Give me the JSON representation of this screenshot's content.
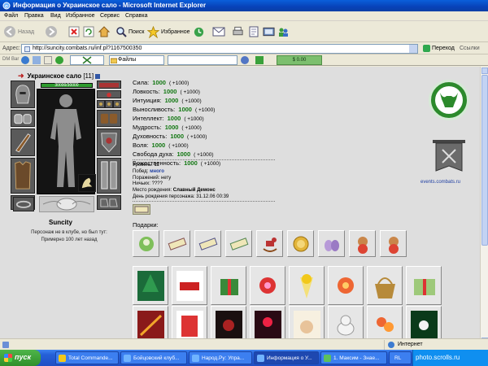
{
  "window": {
    "title": "Информация о Украинское сало - Microsoft Internet Explorer"
  },
  "menu": [
    "Файл",
    "Правка",
    "Вид",
    "Избранное",
    "Сервис",
    "Справка"
  ],
  "toolbar": {
    "back": "Назад",
    "search": "Поиск",
    "favorites": "Избранное"
  },
  "address": {
    "label": "Адрес:",
    "url": "http://suncity.combats.ru/inf.pl?1167500350",
    "go": "Переход",
    "links": "Ссылки"
  },
  "dmbar": {
    "label": "DM Bar",
    "files": "Файлы",
    "balance": "$ 0.00"
  },
  "character": {
    "name_line": "Украинское сало",
    "level_tag": "[11]",
    "hp": "30000/30000",
    "city": "Suncity",
    "note_line1": "Персонаж не в клубе, но был тут:",
    "note_line2": "Примерно 100 лет назад"
  },
  "stats": [
    {
      "label": "Сила:",
      "value": "1000",
      "bonus": "( +1000)"
    },
    {
      "label": "Ловкость:",
      "value": "1000",
      "bonus": "( +1000)"
    },
    {
      "label": "Интуиция:",
      "value": "1000",
      "bonus": "( +1000)"
    },
    {
      "label": "Выносливость:",
      "value": "1000",
      "bonus": "( +1000)"
    },
    {
      "label": "Интеллект:",
      "value": "1000",
      "bonus": "( +1000)"
    },
    {
      "label": "Мудрость:",
      "value": "1000",
      "bonus": "( +1000)"
    },
    {
      "label": "Духовность:",
      "value": "1000",
      "bonus": "( +1000)"
    },
    {
      "label": "Воля:",
      "value": "1000",
      "bonus": "( +1000)"
    },
    {
      "label": "Свобода духа:",
      "value": "1000",
      "bonus": "( +1000)"
    },
    {
      "label": "Божественность:",
      "value": "1000",
      "bonus": "( +1000)"
    }
  ],
  "info": {
    "level": "Уровень: 11",
    "wins_label": "Побед: ",
    "wins_value": "много",
    "losses": "Поражений: нету",
    "draws": "Ничьих: ????",
    "birthplace_label": "Место рождения: ",
    "birthplace_value": "Славный Демонс",
    "birthday": "День рождения персонажа: 31.12.06 00:39"
  },
  "gifts": {
    "label": "Подарки:"
  },
  "banner": {
    "label": "events.combats.ru"
  },
  "status": {
    "zone": "Интернет"
  },
  "taskbar": {
    "start": "пуск",
    "tasks": [
      "Total Commande...",
      "Бойцовский клуб...",
      "Народ.Ру: Упра...",
      "Информация о У...",
      "1. Максим - Знае..."
    ],
    "tray": "RL",
    "watermark": "photo.scrolls.ru"
  },
  "colors": {
    "stat_value": "#117711",
    "title_bar": "#0a46c0",
    "emblem": "#2c8a2c"
  }
}
